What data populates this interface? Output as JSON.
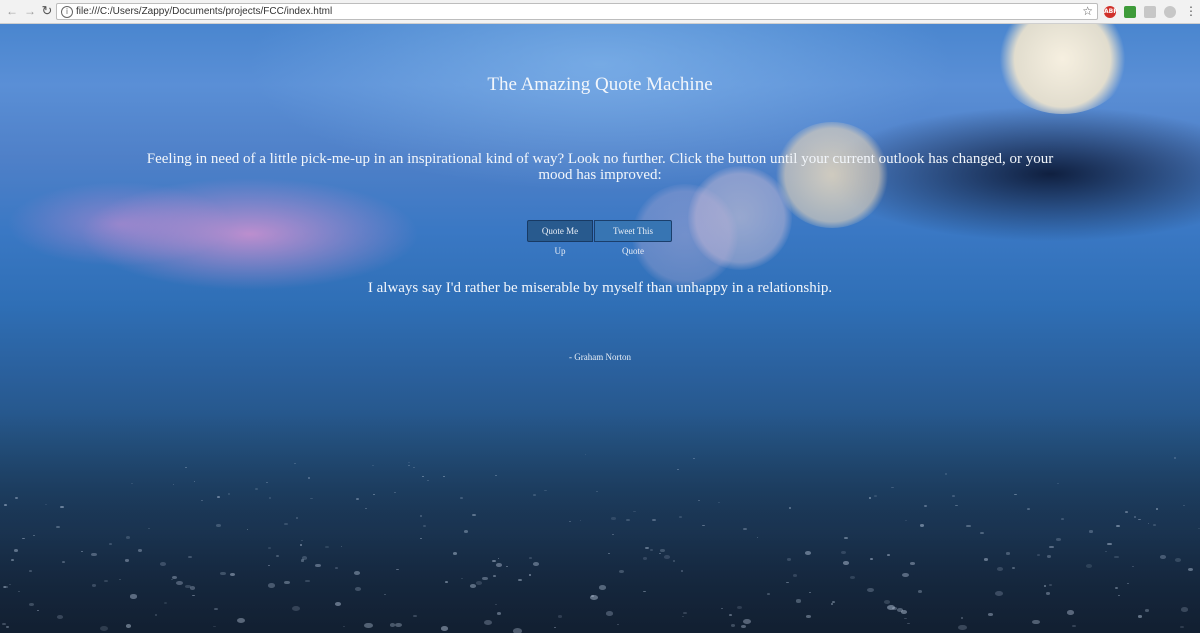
{
  "browser": {
    "url": "file:///C:/Users/Zappy/Documents/projects/FCC/index.html",
    "extensions": [
      {
        "name": "adblock-plus",
        "label": "ABP",
        "color": "#d0302a"
      },
      {
        "name": "green-extension",
        "label": "",
        "color": "#3e9b3a"
      },
      {
        "name": "grey-extension",
        "label": "",
        "color": "#c7c7c7"
      },
      {
        "name": "grey-round-extension",
        "label": "",
        "color": "#c7c7c7"
      }
    ]
  },
  "page": {
    "title": "The Amazing Quote Machine",
    "intro": "Feeling in need of a little pick-me-up in an inspirational kind of way? Look no further. Click the button until your current outlook has changed, or your mood has improved:",
    "buttons": {
      "quote": "Quote Me Up",
      "tweet": "Tweet This Quote"
    },
    "quote": "I always say I'd rather be miserable by myself than unhappy in a relationship.",
    "author": "- Graham Norton"
  },
  "colors": {
    "text": "#f2f6fb",
    "button_quote_bg": "#285a8e",
    "button_tweet_bg": "#3775b3"
  }
}
